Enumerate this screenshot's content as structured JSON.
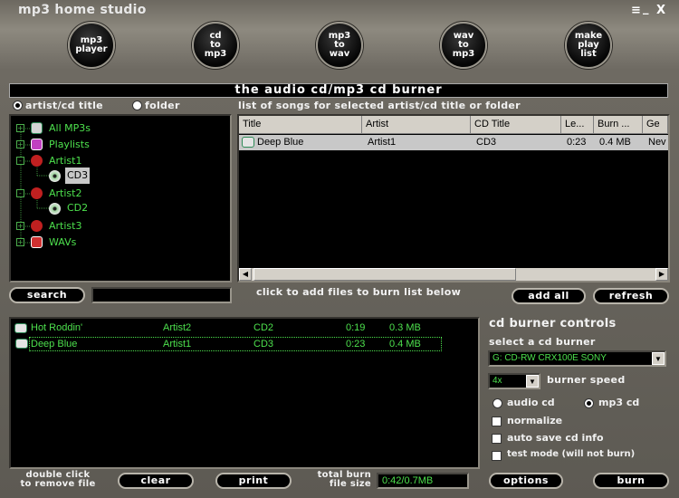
{
  "app_title": "mp3 home studio",
  "window_controls": {
    "menu": "≡",
    "minimize": "_",
    "close": "X"
  },
  "nav_buttons": [
    {
      "label": "mp3\nplayer"
    },
    {
      "label": "cd\nto\nmp3"
    },
    {
      "label": "mp3\nto\nwav"
    },
    {
      "label": "wav\nto\nmp3"
    },
    {
      "label": "make\nplay\nlist"
    }
  ],
  "banner": "the audio cd/mp3 cd burner",
  "source_options": {
    "artist_cd_title": "artist/cd title",
    "folder": "folder",
    "selected": "artist_cd_title"
  },
  "songs_list_label": "list of songs for selected artist/cd title or folder",
  "tree": [
    {
      "label": "All MP3s",
      "icon": "mp3-icon",
      "level": 0,
      "expander": "+"
    },
    {
      "label": "Playlists",
      "icon": "playlist-icon",
      "level": 0,
      "expander": "+"
    },
    {
      "label": "Artist1",
      "icon": "artist-icon",
      "level": 0,
      "expander": "-"
    },
    {
      "label": "CD3",
      "icon": "cd-icon",
      "level": 1,
      "selected": true
    },
    {
      "label": "Artist2",
      "icon": "artist-icon",
      "level": 0,
      "expander": "-"
    },
    {
      "label": "CD2",
      "icon": "cd-icon",
      "level": 1
    },
    {
      "label": "Artist3",
      "icon": "artist-icon",
      "level": 0,
      "expander": "+"
    },
    {
      "label": "WAVs",
      "icon": "wav-icon",
      "level": 0,
      "expander": "+"
    }
  ],
  "songs_table": {
    "columns": [
      "Title",
      "Artist",
      "CD Title",
      "Le...",
      "Burn ...",
      "Ge"
    ],
    "rows": [
      {
        "title": "Deep Blue",
        "artist": "Artist1",
        "cd_title": "CD3",
        "length": "0:23",
        "burn_size": "0.4 MB",
        "genre": "Nev"
      }
    ]
  },
  "search": {
    "button": "search",
    "value": ""
  },
  "add_hint": "click to add files to burn list below",
  "add_all": "add all",
  "refresh": "refresh",
  "burn_list": [
    {
      "title": "Hot Roddin'",
      "artist": "Artist2",
      "cd": "CD2",
      "length": "0:19",
      "size": "0.3 MB"
    },
    {
      "title": "Deep Blue",
      "artist": "Artist1",
      "cd": "CD3",
      "length": "0:23",
      "size": "0.4 MB",
      "focused": true
    }
  ],
  "double_click_hint": "double click\nto remove file",
  "clear": "clear",
  "print": "print",
  "total_burn_label": "total burn\nfile size",
  "total_burn_value": "0:42/0.7MB",
  "controls": {
    "title": "cd burner controls",
    "select_label": "select a cd burner",
    "burner_value": "G: CD-RW  CRX100E  SONY",
    "speed_value": "4x",
    "speed_label": "burner speed",
    "audio_cd": "audio cd",
    "mp3_cd": "mp3 cd",
    "format_selected": "mp3_cd",
    "normalize": "normalize",
    "auto_save": "auto save cd info",
    "test_mode": "test mode (will not burn)",
    "options": "options",
    "burn": "burn"
  }
}
